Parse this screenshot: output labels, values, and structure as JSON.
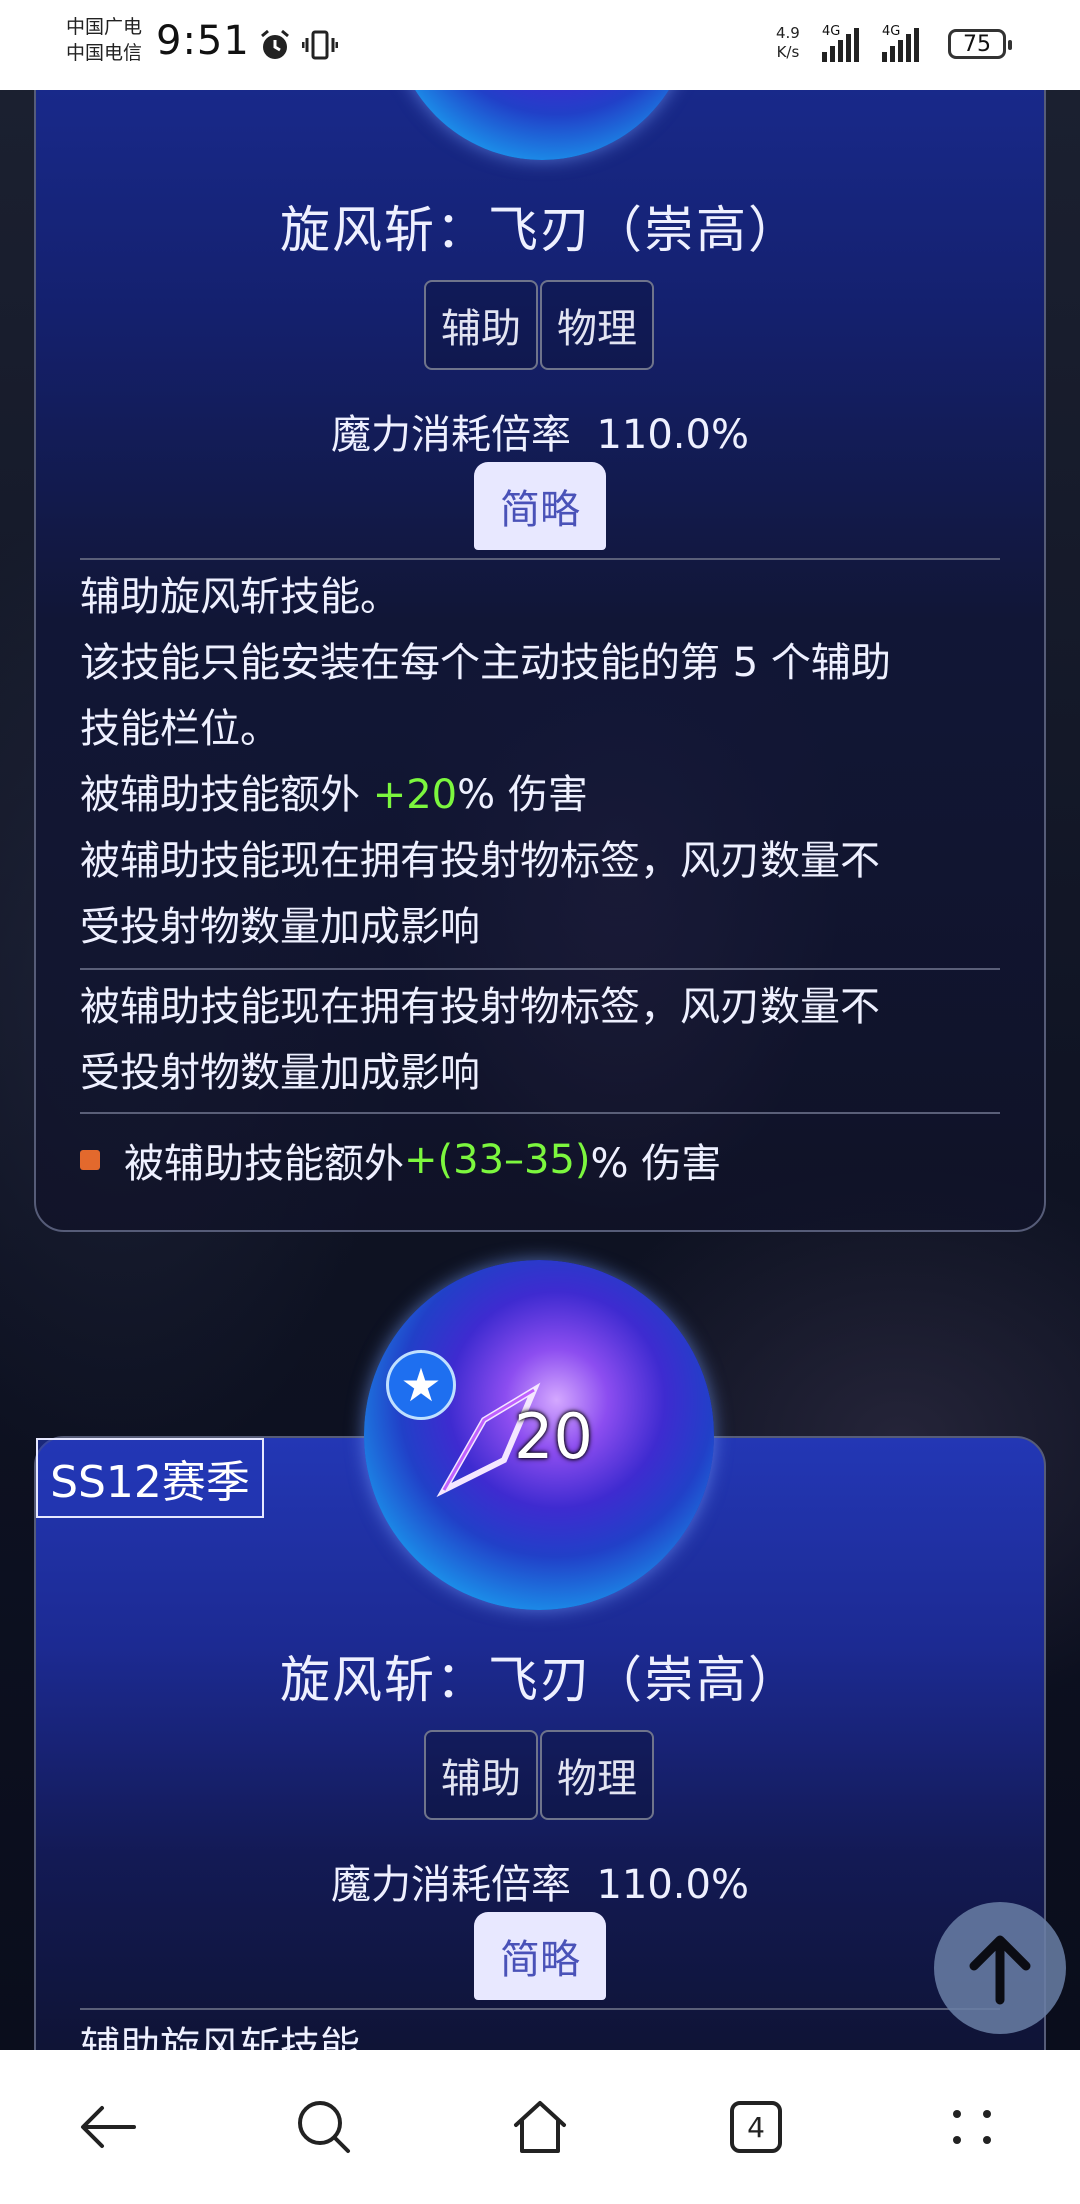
{
  "status": {
    "carrier1": "中国广电",
    "carrier2": "中国电信",
    "time": "9:51",
    "net_speed_value": "4.9",
    "net_speed_unit": "K/s",
    "sim1_label": "4G",
    "sim2_label": "4G",
    "battery": "75"
  },
  "card1": {
    "title": "旋风斩：飞刃（崇高）",
    "tags": [
      "辅助",
      "物理"
    ],
    "mana_label": "魔力消耗倍率",
    "mana_value": "110.0%",
    "brief_button": "简略",
    "desc": {
      "l1": "辅助旋风斩技能。",
      "l2": "该技能只能安装在每个主动技能的第 5 个辅助",
      "l3": "技能栏位。",
      "l4_pre": "被辅助技能额外 ",
      "l4_val": "+20",
      "l4_post": "% 伤害",
      "l5": "被辅助技能现在拥有投射物标签，风刃数量不",
      "l6": "受投射物数量加成影响"
    },
    "extra": {
      "l1": "被辅助技能现在拥有投射物标签，风刃数量不",
      "l2": "受投射物数量加成影响"
    },
    "bullet": {
      "pre": "被辅助技能额外 ",
      "val": "+(33–35)",
      "post": "% 伤害"
    }
  },
  "card2": {
    "season_badge": "SS12赛季",
    "level": "20",
    "title": "旋风斩：飞刃（崇高）",
    "tags": [
      "辅助",
      "物理"
    ],
    "mana_label": "魔力消耗倍率",
    "mana_value": "110.0%",
    "brief_button": "简略",
    "desc_partial": "辅助旋风斩技能"
  },
  "nav": {
    "tab_count": "4"
  },
  "colors": {
    "highlight_green": "#7cf73e",
    "bullet_orange": "#e3692d",
    "card_blue": "#2337b5"
  }
}
